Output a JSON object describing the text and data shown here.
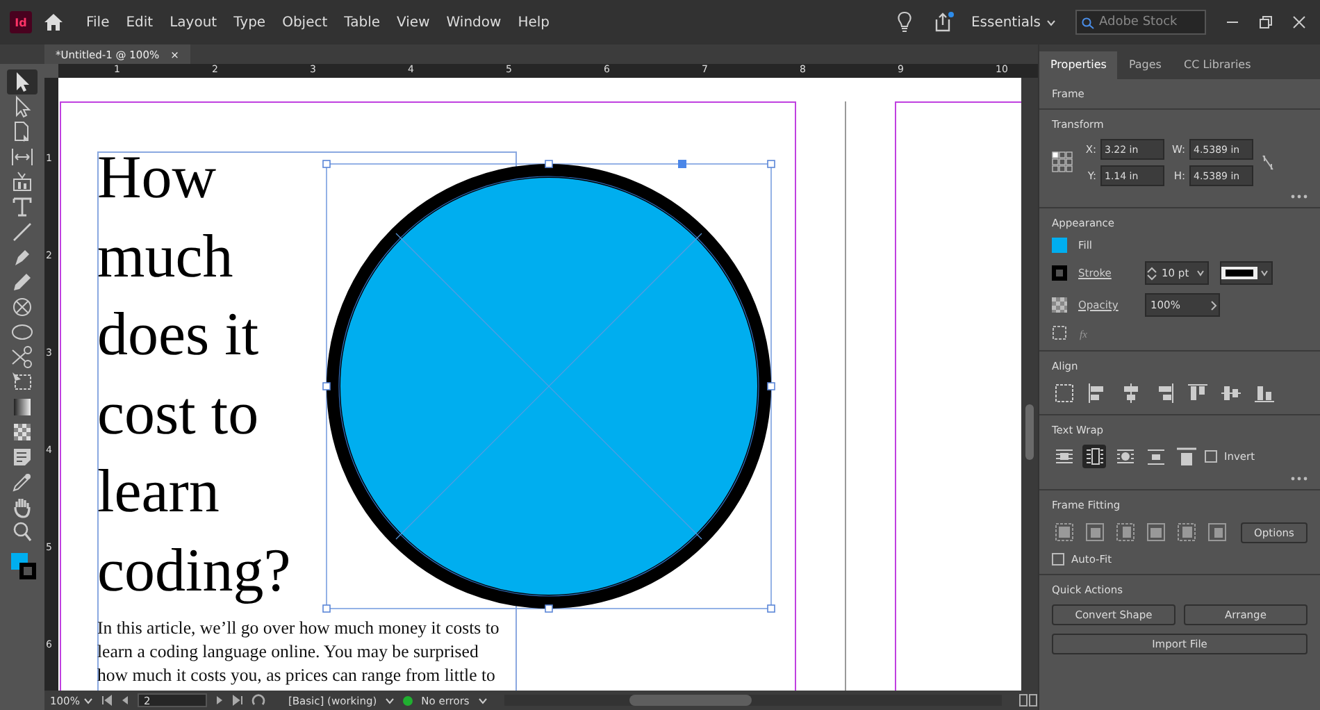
{
  "app": {
    "logo": "Id",
    "menu": [
      "File",
      "Edit",
      "Layout",
      "Type",
      "Object",
      "Table",
      "View",
      "Window",
      "Help"
    ],
    "workspace": "Essentials",
    "search": {
      "placeholder": "Adobe Stock"
    }
  },
  "document_tab": {
    "title": "*Untitled-1 @ 100%",
    "close": "×"
  },
  "rulers": {
    "horizontal": [
      "1",
      "2",
      "3",
      "4",
      "5",
      "6",
      "7",
      "8",
      "9",
      "10"
    ],
    "vertical": [
      "1",
      "2",
      "3",
      "4",
      "5",
      "6"
    ]
  },
  "tools": [
    {
      "kind": "select",
      "selected": true
    },
    {
      "kind": "direct",
      "selected": false
    },
    {
      "kind": "page",
      "selected": false
    },
    {
      "kind": "gap",
      "selected": false
    },
    {
      "kind": "content",
      "selected": false
    },
    {
      "kind": "type",
      "selected": false
    },
    {
      "kind": "line",
      "selected": false
    },
    {
      "kind": "pen",
      "selected": false
    },
    {
      "kind": "pencil",
      "selected": false
    },
    {
      "kind": "rectframe",
      "selected": false
    },
    {
      "kind": "ellipse",
      "selected": false
    },
    {
      "kind": "scissors",
      "selected": false
    },
    {
      "kind": "transform",
      "selected": false
    },
    {
      "kind": "gradient",
      "selected": false
    },
    {
      "kind": "feather",
      "selected": false
    },
    {
      "kind": "note",
      "selected": false
    },
    {
      "kind": "eyedropper",
      "selected": false
    },
    {
      "kind": "hand",
      "selected": false
    },
    {
      "kind": "zoom",
      "selected": false
    }
  ],
  "document": {
    "heading_lines": [
      "How",
      "much",
      "does it",
      "cost to",
      "learn",
      "coding?"
    ],
    "body_lines": [
      "In this article, we’ll go over how much money it costs to",
      "learn a coding language online. You may be surprised",
      "how much it costs you, as prices can range from little to"
    ]
  },
  "panel": {
    "tabs": [
      {
        "label": "Properties",
        "selected": true
      },
      {
        "label": "Pages",
        "selected": false
      },
      {
        "label": "CC Libraries",
        "selected": false
      }
    ],
    "object_type": "Frame",
    "transform": {
      "title": "Transform",
      "fields": [
        {
          "label": "X:",
          "value": "3.22 in"
        },
        {
          "label": "W:",
          "value": "4.5389 in"
        },
        {
          "label": "Y:",
          "value": "1.14 in"
        },
        {
          "label": "H:",
          "value": "4.5389 in"
        }
      ]
    },
    "appearance": {
      "title": "Appearance",
      "fill": {
        "label": "Fill",
        "color": "#00aeef"
      },
      "stroke": {
        "label": "Stroke",
        "color": "#000000",
        "weight": "10 pt"
      },
      "opacity": {
        "label": "Opacity",
        "value": "100%"
      },
      "effects": "fx"
    },
    "align": {
      "title": "Align"
    },
    "text_wrap": {
      "title": "Text Wrap",
      "options": [
        {
          "selected": false
        },
        {
          "selected": true
        },
        {
          "selected": false
        },
        {
          "selected": false
        },
        {
          "selected": false
        }
      ],
      "invert": {
        "label": "Invert",
        "checked": false
      }
    },
    "frame_fitting": {
      "title": "Frame Fitting",
      "options_button": "Options",
      "auto_fit": {
        "label": "Auto-Fit",
        "checked": false
      }
    },
    "quick_actions": {
      "title": "Quick Actions",
      "buttons": [
        "Convert Shape",
        "Arrange",
        "Import File"
      ]
    }
  },
  "status_bar": {
    "zoom": "100%",
    "page": "2",
    "style": "[Basic] (working)",
    "preflight": "No errors"
  }
}
